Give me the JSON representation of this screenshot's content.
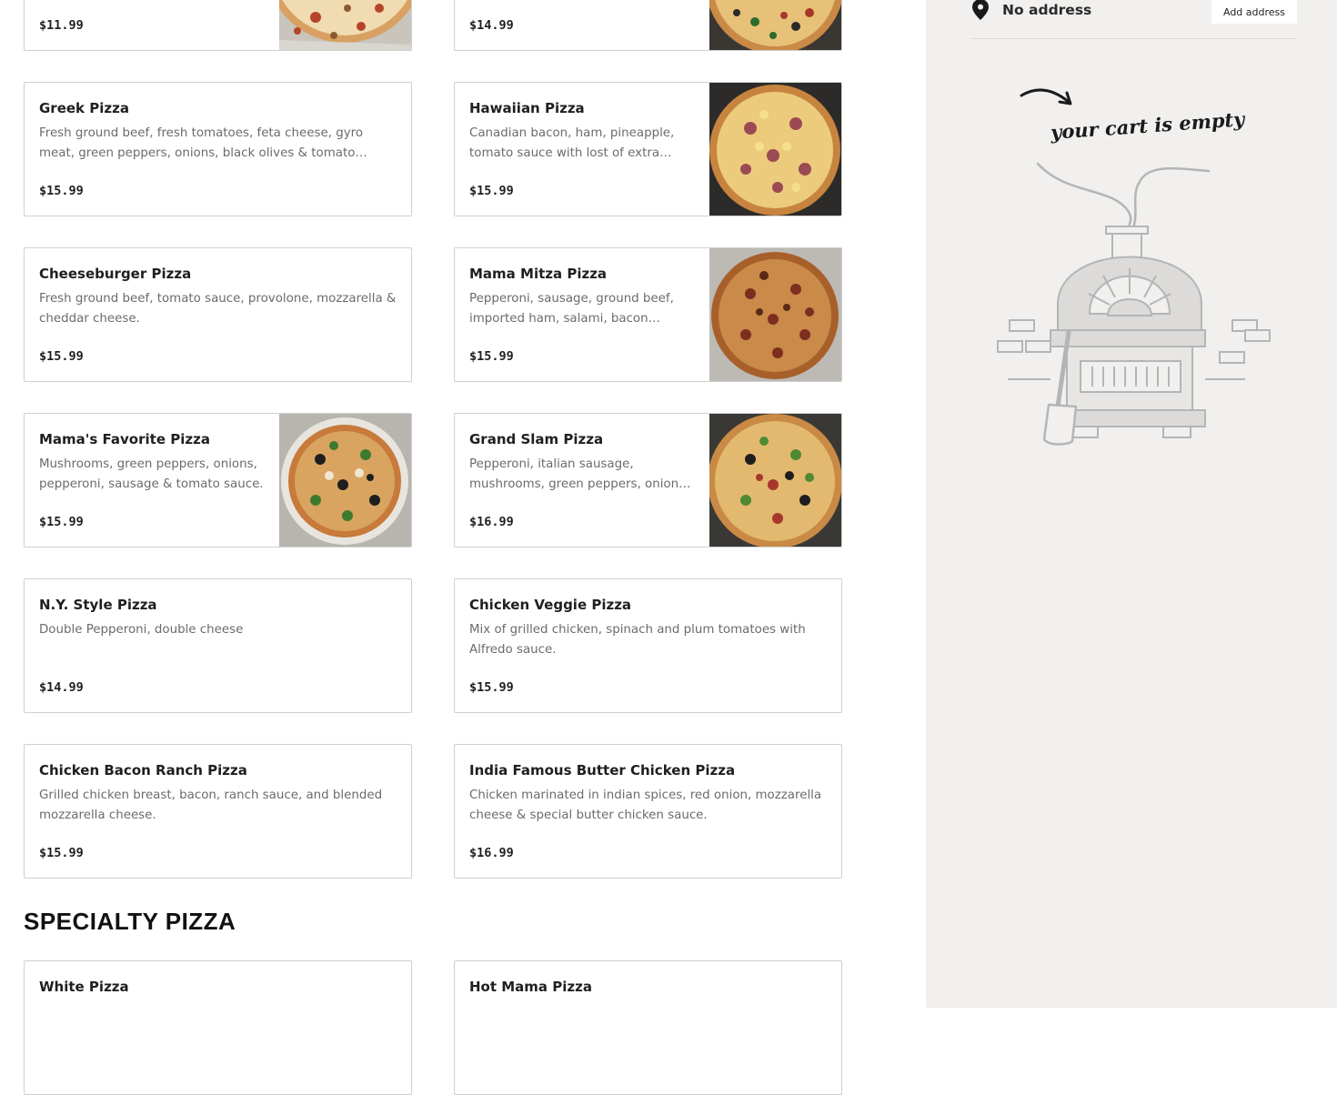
{
  "cart": {
    "address_text": "No address",
    "add_address_label": "Add address",
    "empty_text": "your cart is empty"
  },
  "menu": {
    "section_title": "SPECIALTY PIZZA",
    "top_row_prices": [
      "$11.99",
      "$14.99"
    ],
    "items": [
      {
        "name": "Greek Pizza",
        "description": "Fresh ground beef, fresh tomatoes, feta cheese, gyro meat, green peppers, onions, black olives & tomato sauce.",
        "price": "$15.99"
      },
      {
        "name": "Hawaiian Pizza",
        "description": "Canadian bacon, ham, pineapple, tomato sauce with lost of extra cheese.",
        "price": "$15.99"
      },
      {
        "name": "Cheeseburger Pizza",
        "description": "Fresh ground beef, tomato sauce, provolone, mozzarella & cheddar cheese.",
        "price": "$15.99"
      },
      {
        "name": "Mama Mitza Pizza",
        "description": "Pepperoni, sausage, ground beef, imported ham, salami, bacon tomato...",
        "price": "$15.99"
      },
      {
        "name": "Mama's Favorite Pizza",
        "description": "Mushrooms, green peppers, onions, pepperoni, sausage & tomato sauce.",
        "price": "$15.99"
      },
      {
        "name": "Grand Slam Pizza",
        "description": "Pepperoni, italian sausage, mushrooms, green peppers, onions, fresh ground...",
        "price": "$16.99"
      },
      {
        "name": "N.Y. Style Pizza",
        "description": "Double Pepperoni, double cheese",
        "price": "$14.99"
      },
      {
        "name": "Chicken Veggie Pizza",
        "description": "Mix of grilled chicken, spinach and plum tomatoes with Alfredo sauce.",
        "price": "$15.99"
      },
      {
        "name": "Chicken Bacon Ranch Pizza",
        "description": "Grilled chicken breast, bacon, ranch sauce, and blended mozzarella cheese.",
        "price": "$15.99"
      },
      {
        "name": "India Famous Butter Chicken Pizza",
        "description": "Chicken marinated in indian spices, red onion, mozzarella cheese & special butter chicken sauce.",
        "price": "$16.99"
      }
    ],
    "specialty_items": [
      {
        "name": "White Pizza"
      },
      {
        "name": "Hot Mama Pizza"
      }
    ]
  }
}
